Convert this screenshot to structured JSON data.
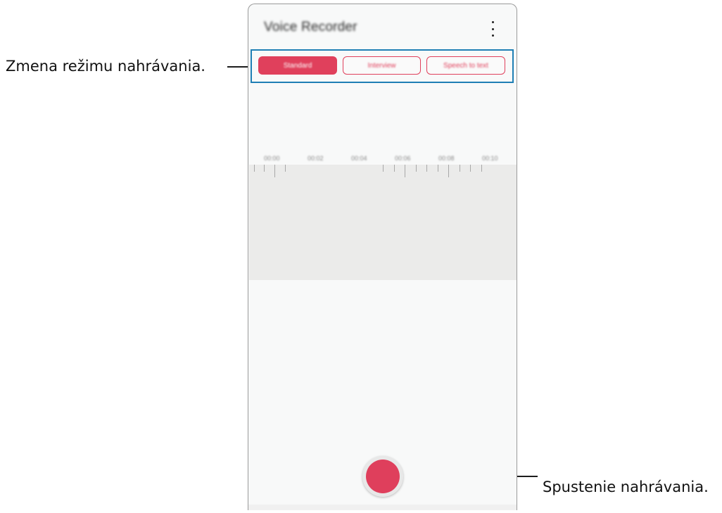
{
  "callouts": {
    "mode_change": "Zmena režimu nahrávania.",
    "start_recording": "Spustenie nahrávania."
  },
  "app": {
    "title": "Voice Recorder",
    "modes": [
      "Standard",
      "Interview",
      "Speech to text"
    ],
    "selected_mode": "Standard",
    "timeline": [
      "00:00",
      "00:02",
      "00:04",
      "00:06",
      "00:08",
      "00:10"
    ]
  },
  "colors": {
    "accent": "#e0405c",
    "callout_box": "#1f7fb5"
  },
  "icons": {
    "menu": "more-vertical-icon",
    "record": "record-icon"
  }
}
